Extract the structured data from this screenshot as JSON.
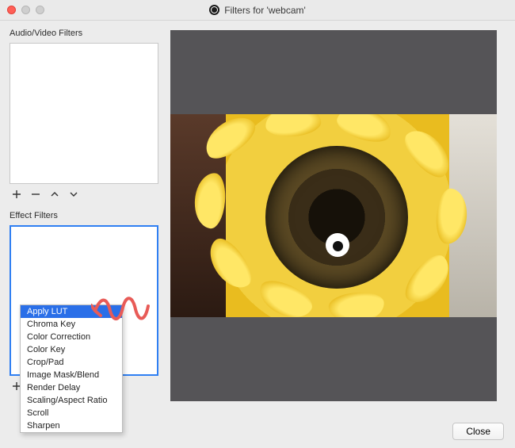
{
  "window": {
    "title": "Filters for 'webcam'"
  },
  "sections": {
    "audio_video_label": "Audio/Video Filters",
    "effect_label": "Effect Filters"
  },
  "controls": {
    "add": "+",
    "remove": "−",
    "up": "˄",
    "down": "˅"
  },
  "context_menu": {
    "items": [
      "Apply LUT",
      "Chroma Key",
      "Color Correction",
      "Color Key",
      "Crop/Pad",
      "Image Mask/Blend",
      "Render Delay",
      "Scaling/Aspect Ratio",
      "Scroll",
      "Sharpen"
    ],
    "selected_index": 0
  },
  "buttons": {
    "close": "Close"
  },
  "annotation": {
    "color": "#e85b57"
  }
}
